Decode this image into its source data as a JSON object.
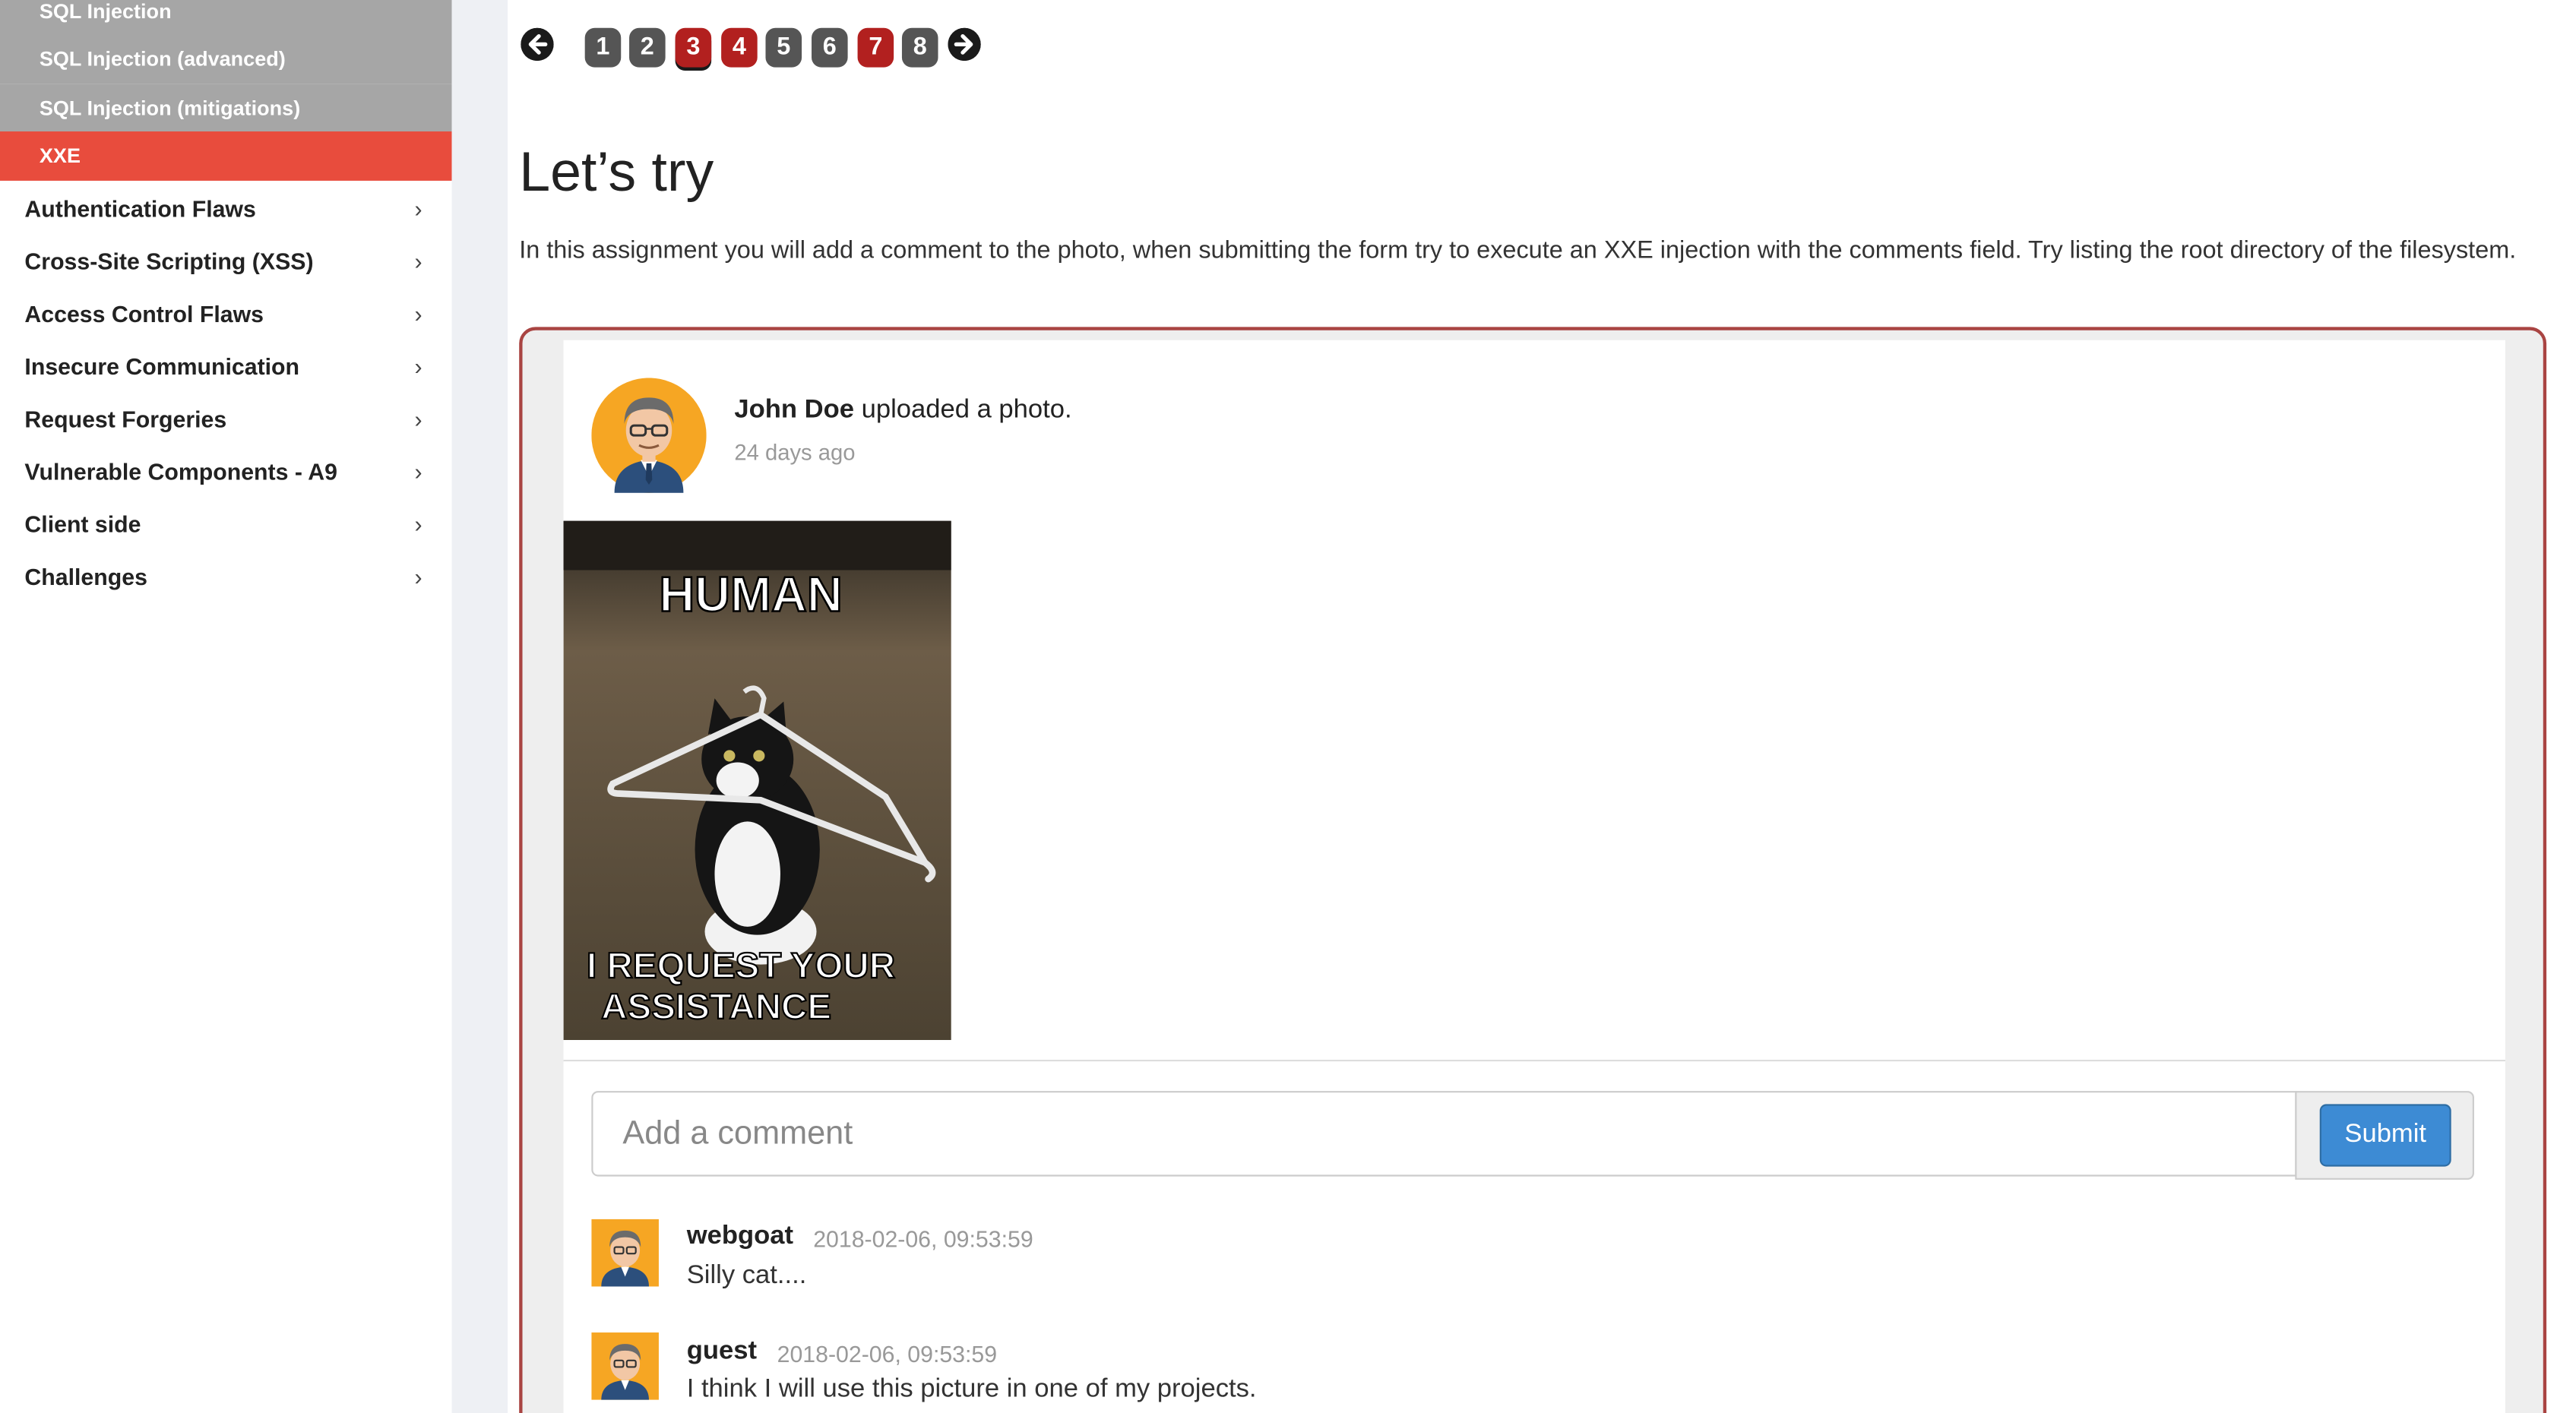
{
  "sidebar": {
    "sub_items": [
      {
        "label": "SQL Injection"
      },
      {
        "label": "SQL Injection (advanced)"
      },
      {
        "label": "SQL Injection (mitigations)"
      },
      {
        "label": "XXE"
      }
    ],
    "items": [
      {
        "label": "Authentication Flaws",
        "chevron": "›"
      },
      {
        "label": "Cross-Site Scripting (XSS)",
        "chevron": "›"
      },
      {
        "label": "Access Control Flaws",
        "chevron": "›"
      },
      {
        "label": "Insecure Communication",
        "chevron": "›"
      },
      {
        "label": "Request Forgeries",
        "chevron": "›"
      },
      {
        "label": "Vulnerable Components - A9",
        "chevron": "›"
      },
      {
        "label": "Client side",
        "chevron": "›"
      },
      {
        "label": "Challenges",
        "chevron": "›"
      }
    ]
  },
  "pager": {
    "prev_icon": "arrow-left-circle-icon",
    "next_icon": "arrow-right-circle-icon",
    "pages": [
      "1",
      "2",
      "3",
      "4",
      "5",
      "6",
      "7",
      "8"
    ],
    "current": "3"
  },
  "lesson": {
    "title": "Let’s try",
    "intro": "In this assignment you will add a comment to the photo, when submitting the form try to execute an XXE injection with the comments field. Try listing the root directory of the filesystem."
  },
  "post": {
    "author": "John Doe",
    "action": " uploaded a photo.",
    "time": "24 days ago",
    "photo_caption_top": "HUMAN",
    "photo_caption_bottom_1": "I REQUEST YOUR",
    "photo_caption_bottom_2": "ASSISTANCE"
  },
  "comment_form": {
    "placeholder": "Add a comment",
    "value": "",
    "submit_label": "Submit"
  },
  "comments": [
    {
      "user": "webgoat",
      "time": "2018-02-06, 09:53:59",
      "text": "Silly cat...."
    },
    {
      "user": "guest",
      "time": "2018-02-06, 09:53:59",
      "text": "I think I will use this picture in one of my projects."
    }
  ],
  "colors": {
    "accent_red": "#e84c3d",
    "sub_grey": "#a6a6a6",
    "page_red": "#b2201f",
    "page_grey": "#555555",
    "frame_border": "#a94442",
    "submit_blue": "#3d8bd4"
  }
}
